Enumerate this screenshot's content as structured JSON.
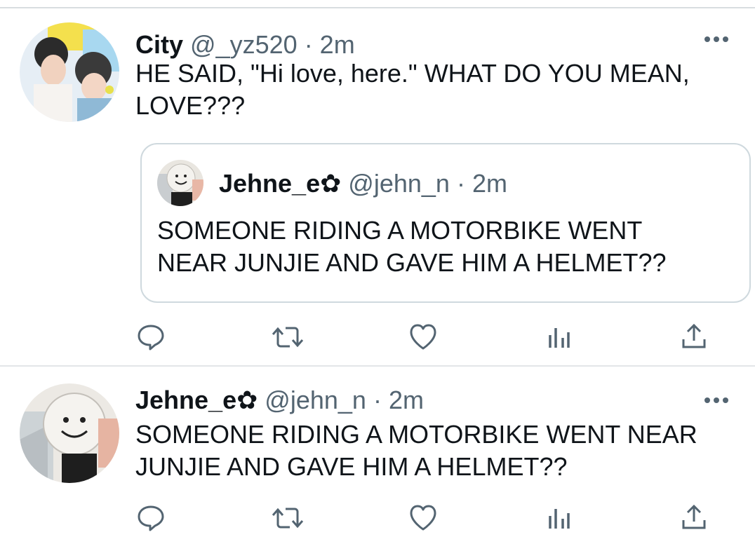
{
  "tweets": [
    {
      "name": "City",
      "handle": "@_yz520",
      "time": "· 2m",
      "text": "HE SAID, \"Hi love, here.\" WHAT DO YOU MEAN, LOVE???",
      "quote": {
        "name": "Jehne_e✿",
        "handle": "@jehn_n",
        "time": "· 2m",
        "text": "SOMEONE RIDING A MOTORBIKE WENT NEAR JUNJIE AND GAVE HIM A HELMET??"
      }
    },
    {
      "name": "Jehne_e✿",
      "handle": "@jehn_n",
      "time": "· 2m",
      "text": "SOMEONE RIDING A MOTORBIKE WENT NEAR JUNJIE AND GAVE HIM A HELMET??"
    }
  ],
  "icons": {
    "actions": [
      "reply-icon",
      "retweet-icon",
      "like-icon",
      "analytics-icon",
      "share-icon"
    ],
    "more": "more-options-icon"
  },
  "colors": {
    "text": "#0f1419",
    "secondary": "#536471",
    "border": "#cfd9de"
  }
}
